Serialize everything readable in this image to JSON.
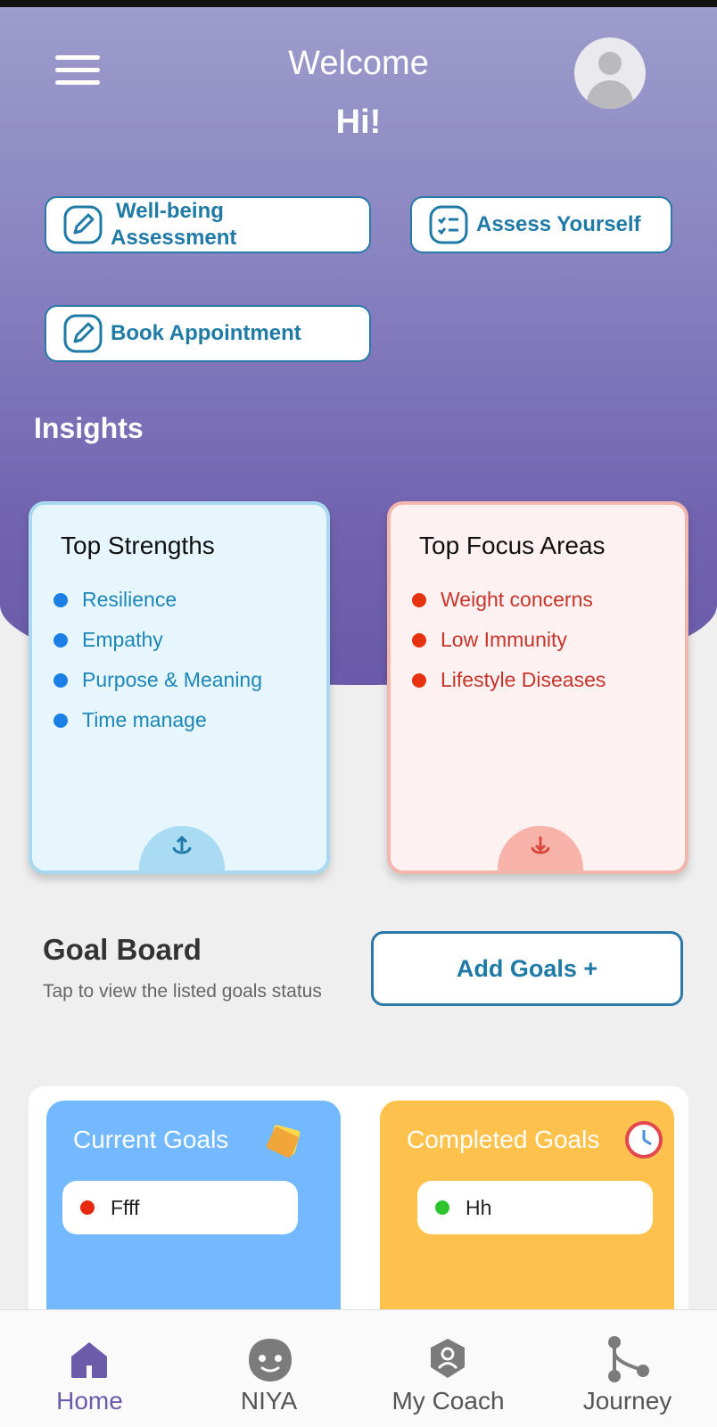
{
  "header": {
    "welcome": "Welcome",
    "greeting": "Hi!"
  },
  "actions": {
    "wellbeing_line1": "Well-being",
    "wellbeing_line2": "Assessment",
    "assess": "Assess Yourself",
    "book": "Book Appointment"
  },
  "insights": {
    "title": "Insights",
    "strengths": {
      "title": "Top Strengths",
      "items": [
        "Resilience",
        "Empathy",
        "Purpose & Meaning",
        "Time manage"
      ]
    },
    "focus": {
      "title": "Top Focus Areas",
      "items": [
        "Weight concerns",
        "Low Immunity",
        "Lifestyle Diseases"
      ]
    }
  },
  "goal_board": {
    "title": "Goal Board",
    "subtitle": "Tap to view the listed goals status",
    "add_label": "Add Goals +",
    "current": {
      "title": "Current Goals",
      "items": [
        "Ffff"
      ]
    },
    "completed": {
      "title": "Completed Goals",
      "items": [
        "Hh"
      ]
    }
  },
  "nav": {
    "items": [
      {
        "label": "Home",
        "icon": "home-icon"
      },
      {
        "label": "NIYA",
        "icon": "niya-bot-icon"
      },
      {
        "label": "My Coach",
        "icon": "coach-icon"
      },
      {
        "label": "Journey",
        "icon": "journey-icon"
      }
    ],
    "active": "Home"
  },
  "colors": {
    "accent": "#1f7aa6",
    "purple": "#6b5ba8",
    "strength_dot": "#1b7fe6",
    "focus_dot": "#e6320f",
    "current_card": "#72b9ff",
    "completed_card": "#ffc24d"
  }
}
